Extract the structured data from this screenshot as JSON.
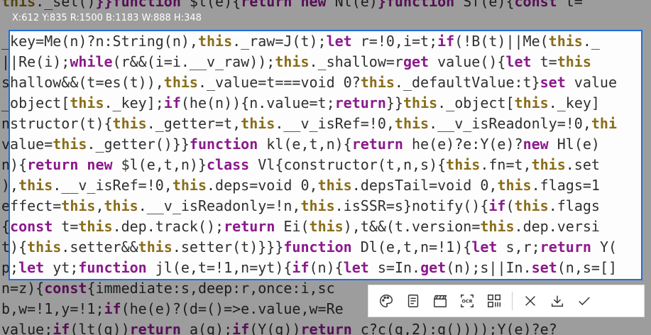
{
  "selection_readout": "X:612 Y:835 R:1500 B:1183 W:888 H:348",
  "code_lines": [
    [
      [
        "th",
        "this"
      ],
      [
        "id",
        "._sel()"
      ],
      [
        "kw",
        "}}function "
      ],
      [
        "id",
        "$l(e){"
      ],
      [
        "kw",
        "return new "
      ],
      [
        "id",
        "Nl(e)"
      ],
      [
        "kw",
        "}function "
      ],
      [
        "id",
        "Sf(e){"
      ],
      [
        "kw",
        "const "
      ],
      [
        "id",
        "t="
      ]
    ],
    [
      [
        "id",
        "|this._sel(t)}}function $l(e){return new Nl(e)}function Sf(e){const t="
      ]
    ],
    [
      [
        "id",
        "_key=Me(n)?n:String(n),"
      ],
      [
        "th",
        "this"
      ],
      [
        "id",
        "._raw=J(t);"
      ],
      [
        "kw",
        "let "
      ],
      [
        "id",
        "r=!0,i=t;"
      ],
      [
        "kw",
        "if"
      ],
      [
        "id",
        "(!B(t)||Me("
      ],
      [
        "th",
        "this"
      ],
      [
        "id",
        "._"
      ]
    ],
    [
      [
        "id",
        "||Re(i);"
      ],
      [
        "kw",
        "while"
      ],
      [
        "id",
        "(r&&(i=i.__v_raw));"
      ],
      [
        "th",
        "this"
      ],
      [
        "id",
        "._shallow=r"
      ],
      [
        "kw",
        "get "
      ],
      [
        "id",
        "value(){"
      ],
      [
        "kw",
        "let "
      ],
      [
        "id",
        "t="
      ],
      [
        "th",
        "this"
      ]
    ],
    [
      [
        "id",
        "shallow&&(t=es(t)),"
      ],
      [
        "th",
        "this"
      ],
      [
        "id",
        "._value=t===void 0?"
      ],
      [
        "th",
        "this"
      ],
      [
        "id",
        "._defaultValue:t}"
      ],
      [
        "kw",
        "set "
      ],
      [
        "id",
        "value"
      ]
    ],
    [
      [
        "id",
        "_object["
      ],
      [
        "th",
        "this"
      ],
      [
        "id",
        "._key];"
      ],
      [
        "kw",
        "if"
      ],
      [
        "id",
        "(he(n)){n.value=t;"
      ],
      [
        "kw",
        "return"
      ],
      [
        "id",
        "}}"
      ],
      [
        "th",
        "this"
      ],
      [
        "id",
        "._object["
      ],
      [
        "th",
        "this"
      ],
      [
        "id",
        "._key]"
      ]
    ],
    [
      [
        "id",
        "nstructor(t){"
      ],
      [
        "th",
        "this"
      ],
      [
        "id",
        "._getter=t,"
      ],
      [
        "th",
        "this"
      ],
      [
        "id",
        ".__v_isRef=!0,"
      ],
      [
        "th",
        "this"
      ],
      [
        "id",
        ".__v_isReadonly=!0,"
      ],
      [
        "th",
        "thi"
      ]
    ],
    [
      [
        "id",
        "value="
      ],
      [
        "th",
        "this"
      ],
      [
        "id",
        "._getter()}}"
      ],
      [
        "kw",
        "function "
      ],
      [
        "id",
        "kl(e,t,n){"
      ],
      [
        "kw",
        "return "
      ],
      [
        "id",
        "he(e)?e:Y(e)?"
      ],
      [
        "kw",
        "new "
      ],
      [
        "id",
        "Hl(e)"
      ]
    ],
    [
      [
        "id",
        "n){"
      ],
      [
        "kw",
        "return new "
      ],
      [
        "id",
        "$l(e,t,n)}"
      ],
      [
        "kw",
        "class "
      ],
      [
        "id",
        "Vl{constructor(t,n,s){"
      ],
      [
        "th",
        "this"
      ],
      [
        "id",
        ".fn=t,"
      ],
      [
        "th",
        "this"
      ],
      [
        "id",
        ".set"
      ]
    ],
    [
      [
        "id",
        "),"
      ],
      [
        "th",
        "this"
      ],
      [
        "id",
        ".__v_isRef=!0,"
      ],
      [
        "th",
        "this"
      ],
      [
        "id",
        ".deps=void 0,"
      ],
      [
        "th",
        "this"
      ],
      [
        "id",
        ".depsTail=void 0,"
      ],
      [
        "th",
        "this"
      ],
      [
        "id",
        ".flags=1"
      ]
    ],
    [
      [
        "id",
        "effect="
      ],
      [
        "th",
        "this"
      ],
      [
        "id",
        ","
      ],
      [
        "th",
        "this"
      ],
      [
        "id",
        ".__v_isReadonly=!n,"
      ],
      [
        "th",
        "this"
      ],
      [
        "id",
        ".isSSR=s}notify(){"
      ],
      [
        "kw",
        "if"
      ],
      [
        "id",
        "("
      ],
      [
        "th",
        "this"
      ],
      [
        "id",
        ".flags"
      ]
    ],
    [
      [
        "id",
        "{"
      ],
      [
        "kw",
        "const "
      ],
      [
        "id",
        "t="
      ],
      [
        "th",
        "this"
      ],
      [
        "id",
        ".dep.track();"
      ],
      [
        "kw",
        "return "
      ],
      [
        "id",
        "Ei("
      ],
      [
        "th",
        "this"
      ],
      [
        "id",
        "),t&&(t.version="
      ],
      [
        "th",
        "this"
      ],
      [
        "id",
        ".dep.versi"
      ]
    ],
    [
      [
        "id",
        "t){"
      ],
      [
        "th",
        "this"
      ],
      [
        "id",
        ".setter&&"
      ],
      [
        "th",
        "this"
      ],
      [
        "id",
        ".setter(t)}}}"
      ],
      [
        "kw",
        "function "
      ],
      [
        "id",
        "Dl(e,t,n=!1){"
      ],
      [
        "kw",
        "let "
      ],
      [
        "id",
        "s,r;"
      ],
      [
        "kw",
        "return "
      ],
      [
        "id",
        "Y("
      ]
    ],
    [
      [
        "id",
        "p;"
      ],
      [
        "kw",
        "let "
      ],
      [
        "id",
        "yt;"
      ],
      [
        "kw",
        "function "
      ],
      [
        "id",
        "jl(e,t=!1,n=yt){"
      ],
      [
        "kw",
        "if"
      ],
      [
        "id",
        "(n){"
      ],
      [
        "kw",
        "let "
      ],
      [
        "id",
        "s=In."
      ],
      [
        "kw",
        "get"
      ],
      [
        "id",
        "(n);s||In."
      ],
      [
        "kw",
        "set"
      ],
      [
        "id",
        "(n,s=[]"
      ]
    ],
    [
      [
        "id",
        "n=z){"
      ],
      [
        "kw",
        "const"
      ],
      [
        "id",
        "{immediate:s,deep:r,once:i,sc"
      ]
    ],
    [
      [
        "id",
        "b,w=!1,y=!1;"
      ],
      [
        "kw",
        "if"
      ],
      [
        "id",
        "(he(e)?(d=()=>e.value,w=Re"
      ]
    ],
    [
      [
        "id",
        "value;"
      ],
      [
        "kw",
        "if"
      ],
      [
        "id",
        "(lt(g))"
      ],
      [
        "kw",
        "return "
      ],
      [
        "id",
        "a(g);"
      ],
      [
        "kw",
        "if"
      ],
      [
        "id",
        "(Y(g))"
      ],
      [
        "kw",
        "return "
      ],
      [
        "id",
        "c?c(g,2):g())));Y(e)?e?"
      ]
    ]
  ],
  "toolbar": {
    "buttons": [
      {
        "name": "palette-button",
        "icon": "palette-icon"
      },
      {
        "name": "edit-note-button",
        "icon": "note-icon"
      },
      {
        "name": "video-record-button",
        "icon": "clapper-icon"
      },
      {
        "name": "ocr-button",
        "icon": "ocr-icon",
        "label": "OCR"
      },
      {
        "name": "qrcode-button",
        "icon": "qrcode-icon"
      },
      {
        "name": "cancel-button",
        "icon": "close-icon"
      },
      {
        "name": "save-button",
        "icon": "download-icon"
      },
      {
        "name": "confirm-button",
        "icon": "check-icon"
      }
    ]
  }
}
